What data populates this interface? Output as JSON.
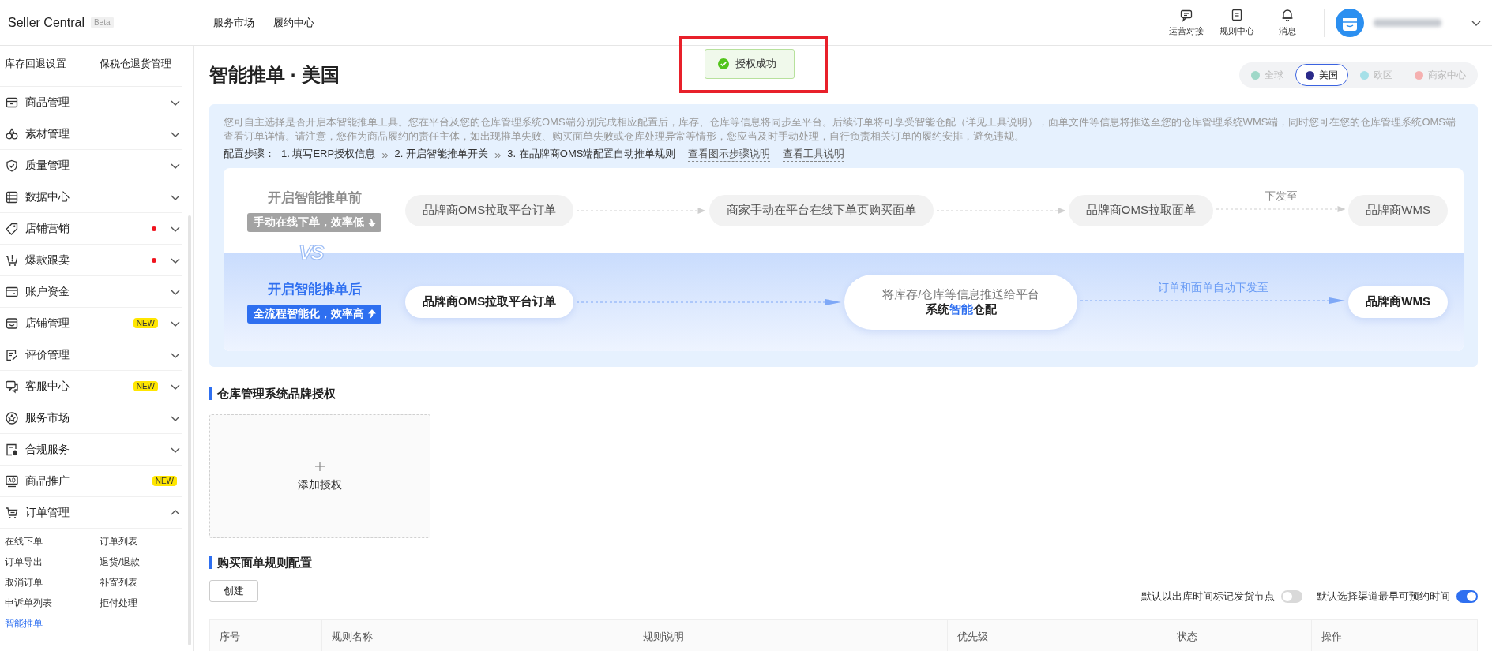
{
  "topbar": {
    "logo": "Seller Central",
    "badge": "Beta",
    "nav": [
      "服务市场",
      "履约中心"
    ],
    "actions": [
      {
        "kind": "chat",
        "label": "运营对接"
      },
      {
        "kind": "rules",
        "label": "规则中心"
      },
      {
        "kind": "bell",
        "label": "消息"
      }
    ]
  },
  "toast": {
    "text": "授权成功",
    "highlighted": true
  },
  "sidebar": {
    "shortcuts": [
      "库存回退设置",
      "保税仓退货管理"
    ],
    "items": [
      {
        "kind": "box",
        "label": "商品管理",
        "notification_dot": false,
        "expanded": false
      },
      {
        "kind": "shapes",
        "label": "素材管理",
        "notification_dot": false,
        "expanded": false
      },
      {
        "kind": "shield",
        "label": "质量管理",
        "notification_dot": false,
        "expanded": false
      },
      {
        "kind": "table",
        "label": "数据中心",
        "notification_dot": false,
        "expanded": false
      },
      {
        "kind": "tag",
        "label": "店铺营销",
        "notification_dot": true,
        "expanded": false
      },
      {
        "kind": "cart-alert",
        "label": "爆款跟卖",
        "notification_dot": true,
        "expanded": false
      },
      {
        "kind": "card",
        "label": "账户资金",
        "notification_dot": false,
        "expanded": false
      },
      {
        "kind": "store",
        "label": "店铺管理",
        "badge": "NEW",
        "notification_dot": false,
        "expanded": false
      },
      {
        "kind": "review",
        "label": "评价管理",
        "notification_dot": false,
        "expanded": false
      },
      {
        "kind": "chat",
        "label": "客服中心",
        "badge": "NEW",
        "notification_dot": false,
        "expanded": false
      },
      {
        "kind": "star",
        "label": "服务市场",
        "notification_dot": false,
        "expanded": false
      },
      {
        "kind": "doc-shield",
        "label": "合规服务",
        "notification_dot": false,
        "expanded": false
      },
      {
        "kind": "ad",
        "label": "商品推广",
        "badge": "NEW",
        "notification_dot": false
      },
      {
        "kind": "cart",
        "label": "订单管理",
        "notification_dot": false,
        "expanded": true,
        "children": [
          {
            "label": "在线下单",
            "selected": false
          },
          {
            "label": "订单列表",
            "selected": false
          },
          {
            "label": "订单导出",
            "selected": false
          },
          {
            "label": "退货/退款",
            "selected": false
          },
          {
            "label": "取消订单",
            "selected": false
          },
          {
            "label": "补寄列表",
            "selected": false
          },
          {
            "label": "申诉单列表",
            "selected": false
          },
          {
            "label": "拒付处理",
            "selected": false
          },
          {
            "label": "智能推单",
            "selected": true
          }
        ]
      }
    ]
  },
  "page": {
    "title": "智能推单 · 美国",
    "regions": [
      {
        "label": "全球",
        "selected": false,
        "color": "#9fd8c8"
      },
      {
        "label": "美国",
        "selected": true,
        "color": "#2b2a8a"
      },
      {
        "label": "欧区",
        "selected": false,
        "color": "#a6e0e8"
      },
      {
        "label": "商家中心",
        "selected": false,
        "color": "#f5b0b0"
      }
    ]
  },
  "intro": {
    "text": "您可自主选择是否开启本智能推单工具。您在平台及您的仓库管理系统OMS端分别完成相应配置后，库存、仓库等信息将同步至平台。后续订单将可享受智能仓配（详见工具说明），面单文件等信息将推送至您的仓库管理系统WMS端，同时您可在您的仓库管理系统OMS端查看订单详情。请注意，您作为商品履约的责任主体，如出现推单失败、购买面单失败或仓库处理异常等情形，您应当及时手动处理，自行负责相关订单的履约安排，避免违规。",
    "steps_label": "配置步骤：",
    "steps": [
      {
        "kind": "step",
        "text": "1. 填写ERP授权信息"
      },
      {
        "kind": "separator",
        "text": "»"
      },
      {
        "kind": "step",
        "text": "2. 开启智能推单开关"
      },
      {
        "kind": "separator",
        "text": "»"
      },
      {
        "kind": "step",
        "text": "3. 在品牌商OMS端配置自动推单规则"
      }
    ],
    "links": [
      "查看图示步骤说明",
      "查看工具说明"
    ]
  },
  "comparison": {
    "vs": "VS",
    "rows": [
      {
        "kind": "before",
        "title": "开启智能推单前",
        "tag": "手动在线下单，效率低",
        "flow": [
          {
            "kind": "node",
            "lines": [
              "品牌商OMS拉取平台订单"
            ]
          },
          {
            "kind": "arrow"
          },
          {
            "kind": "node",
            "lines": [
              "商家手动在平台在线下单页购买面单"
            ]
          },
          {
            "kind": "arrow"
          },
          {
            "kind": "node",
            "lines": [
              "品牌商OMS拉取面单"
            ]
          },
          {
            "kind": "arrow",
            "label": "下发至"
          },
          {
            "kind": "node",
            "lines": [
              "品牌商WMS"
            ]
          }
        ]
      },
      {
        "kind": "after",
        "title": "开启智能推单后",
        "tag": "全流程智能化，效率高",
        "flow": [
          {
            "kind": "node",
            "lines": [
              "品牌商OMS拉取平台订单"
            ]
          },
          {
            "kind": "arrow"
          },
          {
            "kind": "node",
            "lines": [
              "将库存/仓库等信息推送给平台",
              "系统**智能**仓配"
            ]
          },
          {
            "kind": "arrow",
            "label": "订单和面单自动下发至"
          },
          {
            "kind": "node",
            "lines": [
              "品牌商WMS"
            ]
          }
        ]
      }
    ]
  },
  "auth_section": {
    "title": "仓库管理系统品牌授权",
    "add_label": "添加授权"
  },
  "rules_section": {
    "title": "购买面单规则配置",
    "create_button": "创建",
    "toggles": [
      {
        "label": "默认以出库时间标记发货节点",
        "on": false
      },
      {
        "label": "默认选择渠道最早可预约时间",
        "on": true
      }
    ],
    "table": {
      "columns": [
        "序号",
        "规则名称",
        "规则说明",
        "优先级",
        "状态",
        "操作"
      ]
    }
  }
}
